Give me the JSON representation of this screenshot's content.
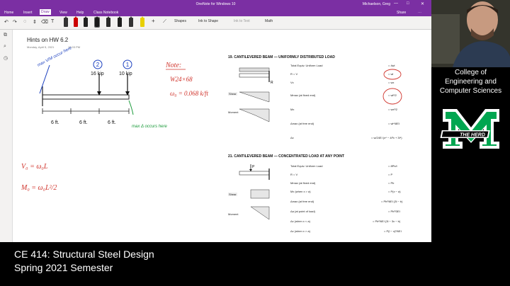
{
  "window": {
    "title": "OneNote for Windows 10",
    "user": "Michaelson, Greg",
    "controls": [
      "—",
      "□",
      "✕"
    ]
  },
  "menu": {
    "tabs": [
      "Home",
      "Insert",
      "Draw",
      "View",
      "Help",
      "Class Notebook"
    ],
    "active": "Draw",
    "right": [
      "Share",
      "⋯"
    ]
  },
  "ribbon": {
    "tools": [
      "Shapes",
      "Ink to Shape",
      "Ink to Text",
      "Math"
    ]
  },
  "page": {
    "title": "Hints on HW 6.2",
    "date": "Monday, April 5, 2021",
    "time": "12:03 PM"
  },
  "notes": {
    "load1_label": "16 kip",
    "load2_label": "10 kip",
    "span1": "6 ft.",
    "span2": "6 ft.",
    "span3": "6 ft.",
    "callout1_num": "2",
    "callout2_num": "1",
    "max_vm": "max V/M occur here",
    "max_delta": "max Δ occurs here",
    "note_title": "Note:",
    "note_line1": "W24×68",
    "note_line2": "ω₀ = 0.068 k/ft",
    "eq1": "V₀ = ω₀L",
    "eq2": "M₀ = ω₀L²/2"
  },
  "doc": {
    "sec19": "19. CANTILEVERED BEAM — UNIFORMLY DISTRIBUTED LOAD",
    "sec21": "21. CANTILEVERED BEAM — CONCENTRATED LOAD AT ANY POINT",
    "rows19": [
      [
        "Total Equiv. Uniform Load",
        "= 4wl"
      ],
      [
        "R = V",
        "= wl"
      ],
      [
        "Vx",
        "= wx"
      ],
      [
        "Mmax (at fixed end)",
        "= wl²/2"
      ],
      [
        "Mx",
        "= wx²/2"
      ],
      [
        "Δmax (at free end)",
        "= wl⁴/8EI"
      ],
      [
        "Δx",
        "= w/24EI (x⁴ − 4l³x + 3l⁴)"
      ]
    ],
    "rows21": [
      [
        "Total Equiv. Uniform Load",
        "= 8Pb/l"
      ],
      [
        "R = V",
        "= P"
      ],
      [
        "Mmax (at fixed end)",
        "= Pb"
      ],
      [
        "Mx (when x > a)",
        "= P(x − a)"
      ],
      [
        "Δmax (at free end)",
        "= Pb²/6EI (3l − b)"
      ],
      [
        "Δa (at point of load)",
        "= Pb³/3EI"
      ],
      [
        "Δx (when x < a)",
        "= Pb²/6EI (3l − 3x − b)"
      ],
      [
        "Δx (when x > a)",
        "= P(l − x)²/6EI"
      ]
    ],
    "labels": [
      "Shear",
      "Moment",
      "Shear",
      "Moment"
    ]
  },
  "brand": {
    "college": [
      "College of",
      "Engineering and",
      "Computer Sciences"
    ],
    "logo_letter": "M",
    "logo_text": "THE HERD",
    "green": "#00a650"
  },
  "caption": {
    "course": "CE 414:  Structural Steel Design",
    "term": "Spring 2021 Semester"
  }
}
